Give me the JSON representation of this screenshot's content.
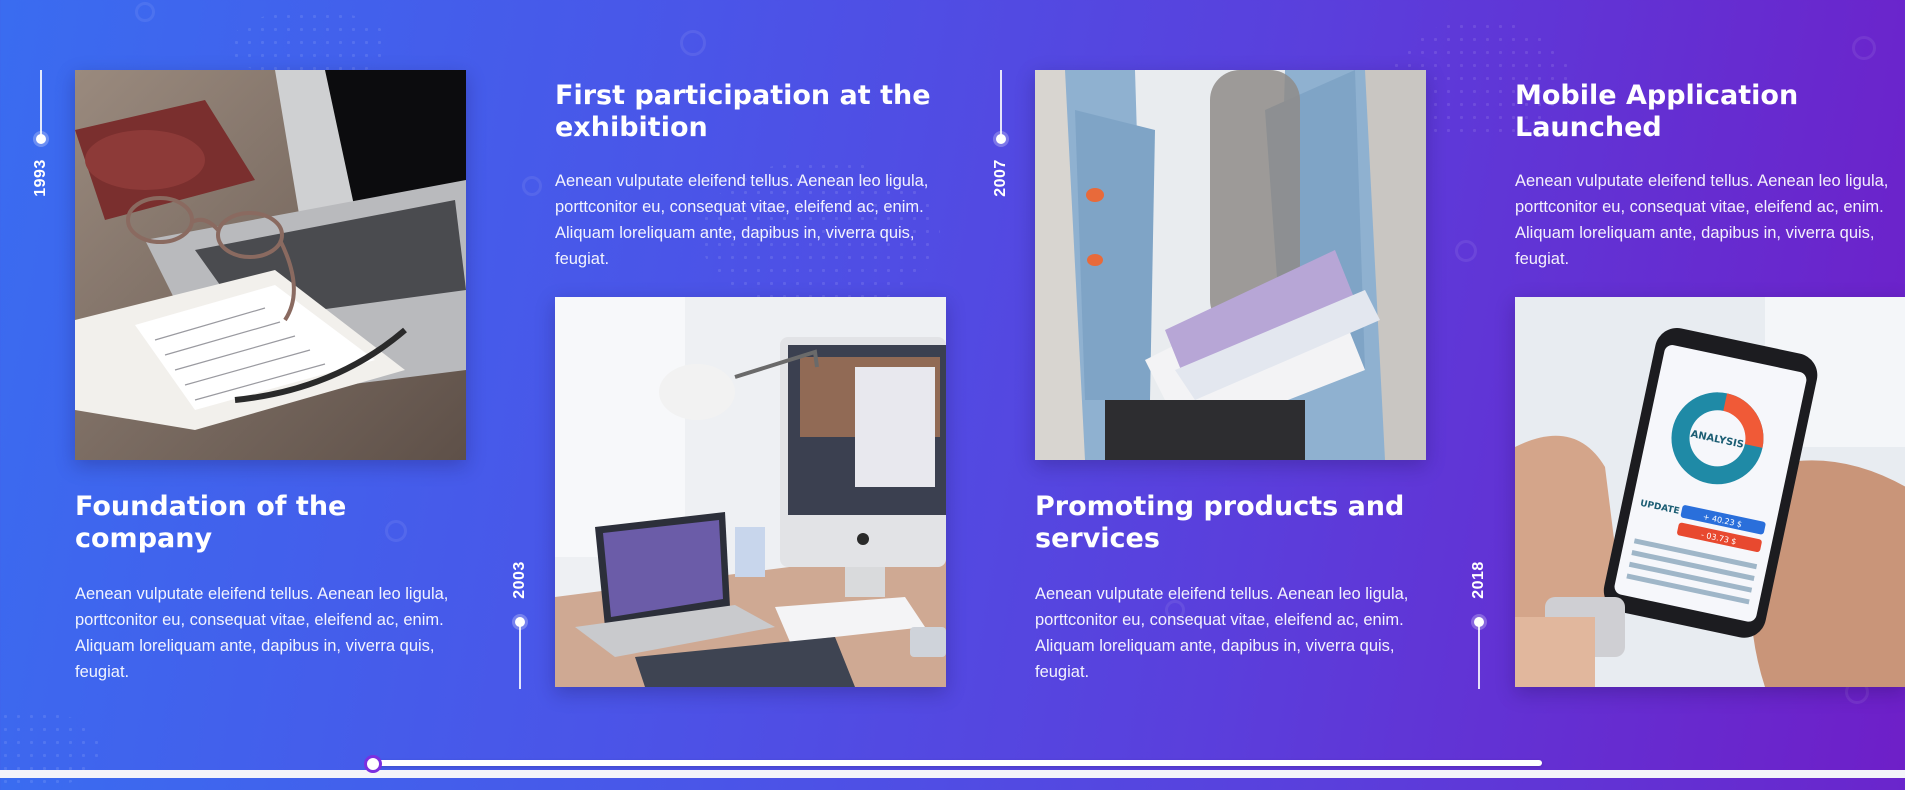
{
  "timeline": {
    "items": [
      {
        "year": "1993",
        "title": "Foundation of the company",
        "description": "Aenean vulputate eleifend tellus. Aenean leo ligula, porttconitor eu, consequat vitae, eleifend ac, enim. Aliquam loreliquam ante, dapibus in, viverra quis, feugiat.",
        "image": "laptop-notebook-glasses-photo"
      },
      {
        "year": "2003",
        "title": "First participation at the exhibition",
        "description": "Aenean vulputate eleifend tellus. Aenean leo ligula, porttconitor eu, consequat vitae, eleifend ac, enim. Aliquam loreliquam ante, dapibus in, viverra quis, feugiat.",
        "image": "desk-imac-laptop-lamp-photo"
      },
      {
        "year": "2007",
        "title": "Promoting products and services",
        "description": "Aenean vulputate eleifend tellus. Aenean leo ligula, porttconitor eu, consequat vitae, eleifend ac, enim. Aliquam loreliquam ante, dapibus in, viverra quis, feugiat.",
        "image": "student-with-books-photo"
      },
      {
        "year": "2018",
        "title": "Mobile Application Launched",
        "description": "Aenean vulputate eleifend tellus. Aenean leo ligula, porttconitor eu, consequat vitae, eleifend ac, enim. Aliquam loreliquam ante, dapibus in, viverra quis, feugiat.",
        "image": "hands-holding-smartphone-photo"
      }
    ]
  },
  "phone_screen": {
    "chart_label": "ANALYSIS",
    "update_label": "UPDATE",
    "value_1": "+ 40.23 $",
    "value_2": "- 03.73 $"
  },
  "scrollbar": {
    "position_fraction": 0.0
  },
  "colors": {
    "gradient_start": "#3a6cf0",
    "gradient_end": "#6e1fc8",
    "scroll_thumb_border": "#7b2fe0"
  }
}
